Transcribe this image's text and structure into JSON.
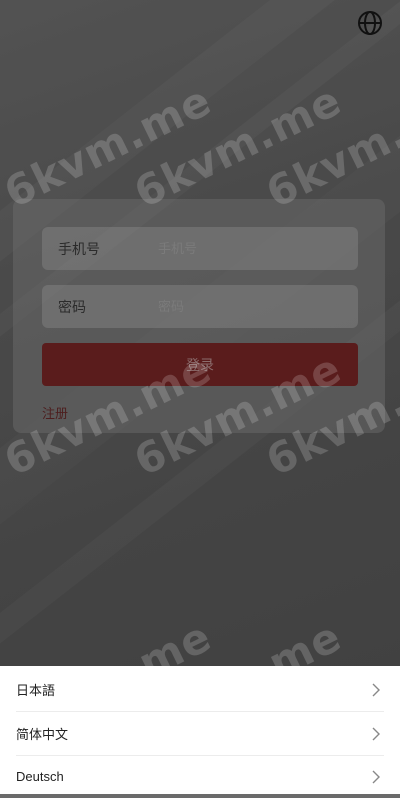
{
  "login": {
    "phone_label": "手机号",
    "phone_placeholder": "手机号",
    "password_label": "密码",
    "password_placeholder": "密码",
    "login_button": "登录",
    "register_link": "注册"
  },
  "watermark_text": "6kvm.me",
  "language_sheet": {
    "items": [
      {
        "label": "日本語"
      },
      {
        "label": "简体中文"
      },
      {
        "label": "Deutsch"
      }
    ]
  },
  "icons": [
    "globe-icon",
    "chevron-right-icon"
  ],
  "colors": {
    "login_button": "#5a1c1c",
    "sheet_bg": "#ffffff"
  }
}
